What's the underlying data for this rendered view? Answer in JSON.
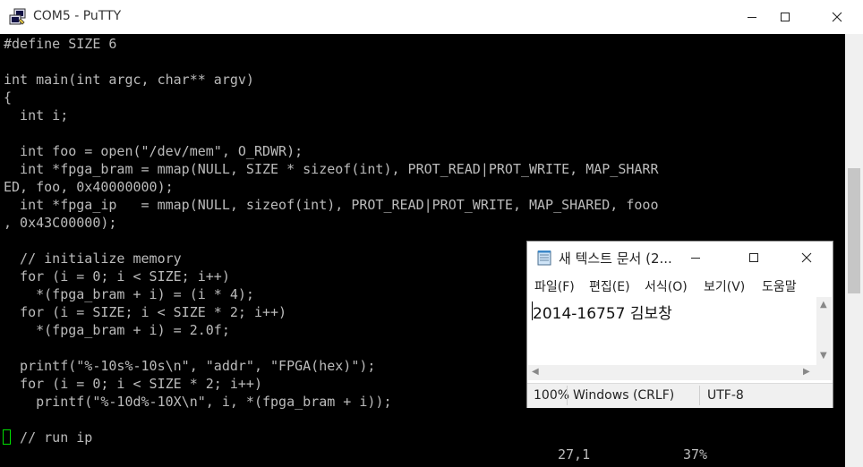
{
  "putty": {
    "title": "COM5 - PuTTY",
    "lines": [
      "#define SIZE 6",
      "",
      "int main(int argc, char** argv)",
      "{",
      "  int i;",
      "",
      "  int foo = open(\"/dev/mem\", O_RDWR);",
      "  int *fpga_bram = mmap(NULL, SIZE * sizeof(int), PROT_READ|PROT_WRITE, MAP_SHARR",
      "ED, foo, 0x40000000);",
      "  int *fpga_ip   = mmap(NULL, sizeof(int), PROT_READ|PROT_WRITE, MAP_SHARED, fooo",
      ", 0x43C00000);",
      "",
      "  // initialize memory",
      "  for (i = 0; i < SIZE; i++)",
      "    *(fpga_bram + i) = (i * 4);",
      "  for (i = SIZE; i < SIZE * 2; i++)",
      "    *(fpga_bram + i) = 2.0f;",
      "",
      "  printf(\"%-10s%-10s\\n\", \"addr\", \"FPGA(hex)\");",
      "  for (i = 0; i < SIZE * 2; i++)",
      "    printf(\"%-10d%-10X\\n\", i, *(fpga_bram + i));",
      "",
      "  // run ip"
    ],
    "status": {
      "position": "27,1",
      "percent": "37%"
    },
    "colors": {
      "background": "#000000",
      "text": "#bbbbbb",
      "cursor": "#00e000"
    }
  },
  "notepad": {
    "title": "새 텍스트 문서 (2...",
    "menu": {
      "file": "파일(F)",
      "edit": "편집(E)",
      "format": "서식(O)",
      "view": "보기(V)",
      "help": "도움말"
    },
    "content": "2014-16757 김보창",
    "status": {
      "zoom": "100%",
      "line_ending": "Windows (CRLF)",
      "encoding": "UTF-8"
    }
  }
}
